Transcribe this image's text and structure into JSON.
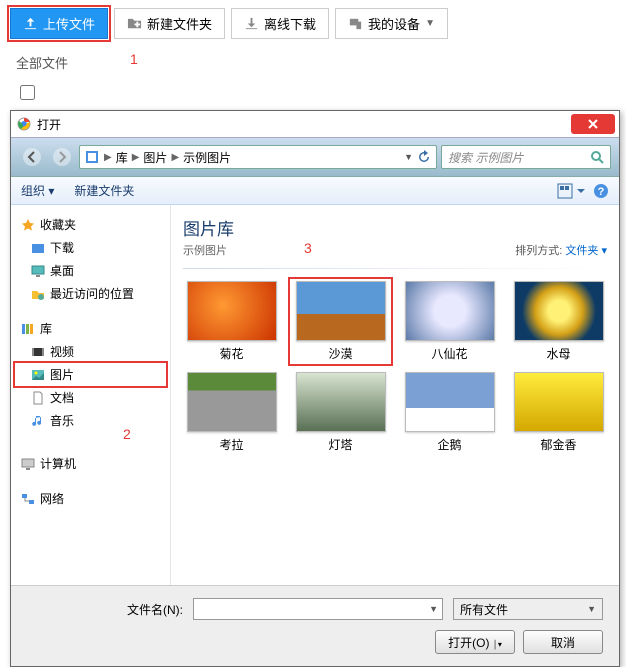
{
  "toolbar": {
    "upload": "上传文件",
    "newfolder": "新建文件夹",
    "offline": "离线下载",
    "devices": "我的设备"
  },
  "breadcrumb": "全部文件",
  "annotations": {
    "a1": "1",
    "a2": "2",
    "a3": "3"
  },
  "dialog": {
    "title": "打开",
    "path": {
      "seg1": "库",
      "seg2": "图片",
      "seg3": "示例图片"
    },
    "search_placeholder": "搜索 示例图片",
    "orgbar": {
      "organize": "组织 ▾",
      "newfolder": "新建文件夹"
    },
    "sidebar": {
      "favorites": "收藏夹",
      "fav_items": [
        "下载",
        "桌面",
        "最近访问的位置"
      ],
      "libraries": "库",
      "lib_items": [
        "视频",
        "图片",
        "文档",
        "音乐"
      ],
      "computer": "计算机",
      "network": "网络"
    },
    "content": {
      "title": "图片库",
      "subtitle": "示例图片",
      "sort_label": "排列方式:",
      "sort_value": "文件夹 ▾",
      "thumbs": [
        {
          "label": "菊花"
        },
        {
          "label": "沙漠"
        },
        {
          "label": "八仙花"
        },
        {
          "label": "水母"
        },
        {
          "label": "考拉"
        },
        {
          "label": "灯塔"
        },
        {
          "label": "企鹅"
        },
        {
          "label": "郁金香"
        }
      ]
    },
    "footer": {
      "filename_label": "文件名(N):",
      "filter": "所有文件",
      "open": "打开(O)",
      "cancel": "取消"
    }
  }
}
